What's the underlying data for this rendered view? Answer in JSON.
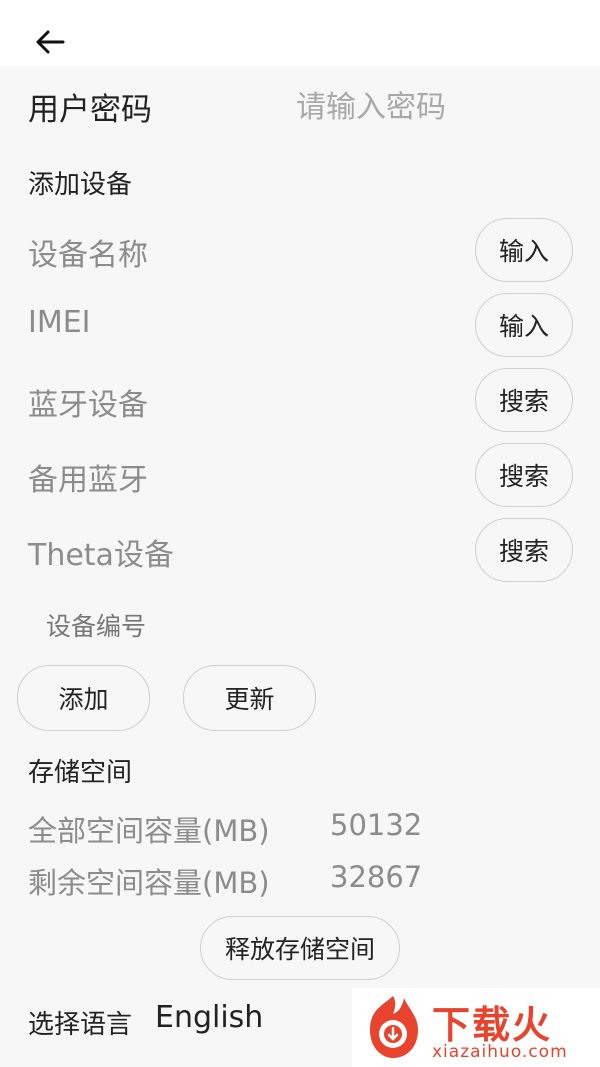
{
  "header": {
    "back_icon": "arrow-left-icon"
  },
  "password": {
    "label": "用户密码",
    "placeholder": "请输入密码",
    "value": ""
  },
  "add_device": {
    "title": "添加设备",
    "rows": [
      {
        "label": "设备名称",
        "button": "输入"
      },
      {
        "label": "IMEI",
        "button": "输入"
      },
      {
        "label": "蓝牙设备",
        "button": "搜索"
      },
      {
        "label": "备用蓝牙",
        "button": "搜索"
      },
      {
        "label": "Theta设备",
        "button": "搜索"
      }
    ],
    "device_number_label": "设备编号",
    "add_button": "添加",
    "update_button": "更新"
  },
  "storage": {
    "title": "存储空间",
    "total_label": "全部空间容量(MB)",
    "total_value": "50132",
    "free_label": "剩余空间容量(MB)",
    "free_value": "32867",
    "release_button": "释放存储空间"
  },
  "language": {
    "label": "选择语言",
    "value": "English"
  },
  "watermark": {
    "title": "下载火",
    "url": "xiazaihuo.com",
    "color": "#e8432c"
  }
}
